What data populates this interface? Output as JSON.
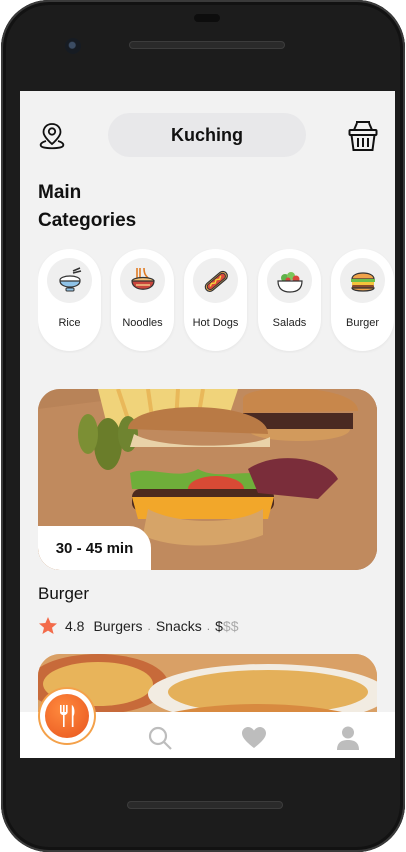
{
  "header": {
    "city": "Kuching"
  },
  "section": {
    "title_line1": "Main",
    "title_line2": "Categories"
  },
  "categories": [
    {
      "label": "Rice",
      "icon": "rice-bowl-icon"
    },
    {
      "label": "Noodles",
      "icon": "noodles-icon"
    },
    {
      "label": "Hot Dogs",
      "icon": "hot-dog-icon"
    },
    {
      "label": "Salads",
      "icon": "salad-icon"
    },
    {
      "label": "Burger",
      "icon": "burger-icon"
    }
  ],
  "featured": {
    "delivery_time": "30 - 45 min",
    "name": "Burger",
    "rating": "4.8",
    "tag1": "Burgers",
    "tag2": "Snacks",
    "price_active": "$",
    "price_inactive": "$$",
    "separator": "."
  },
  "nav": [
    {
      "icon": "fork-knife-icon",
      "active": true
    },
    {
      "icon": "search-icon",
      "active": false
    },
    {
      "icon": "heart-icon",
      "active": false
    },
    {
      "icon": "user-icon",
      "active": false
    }
  ],
  "colors": {
    "accent": "#f06a2b",
    "star": "#f36b4a",
    "background": "#f2f2f2"
  }
}
